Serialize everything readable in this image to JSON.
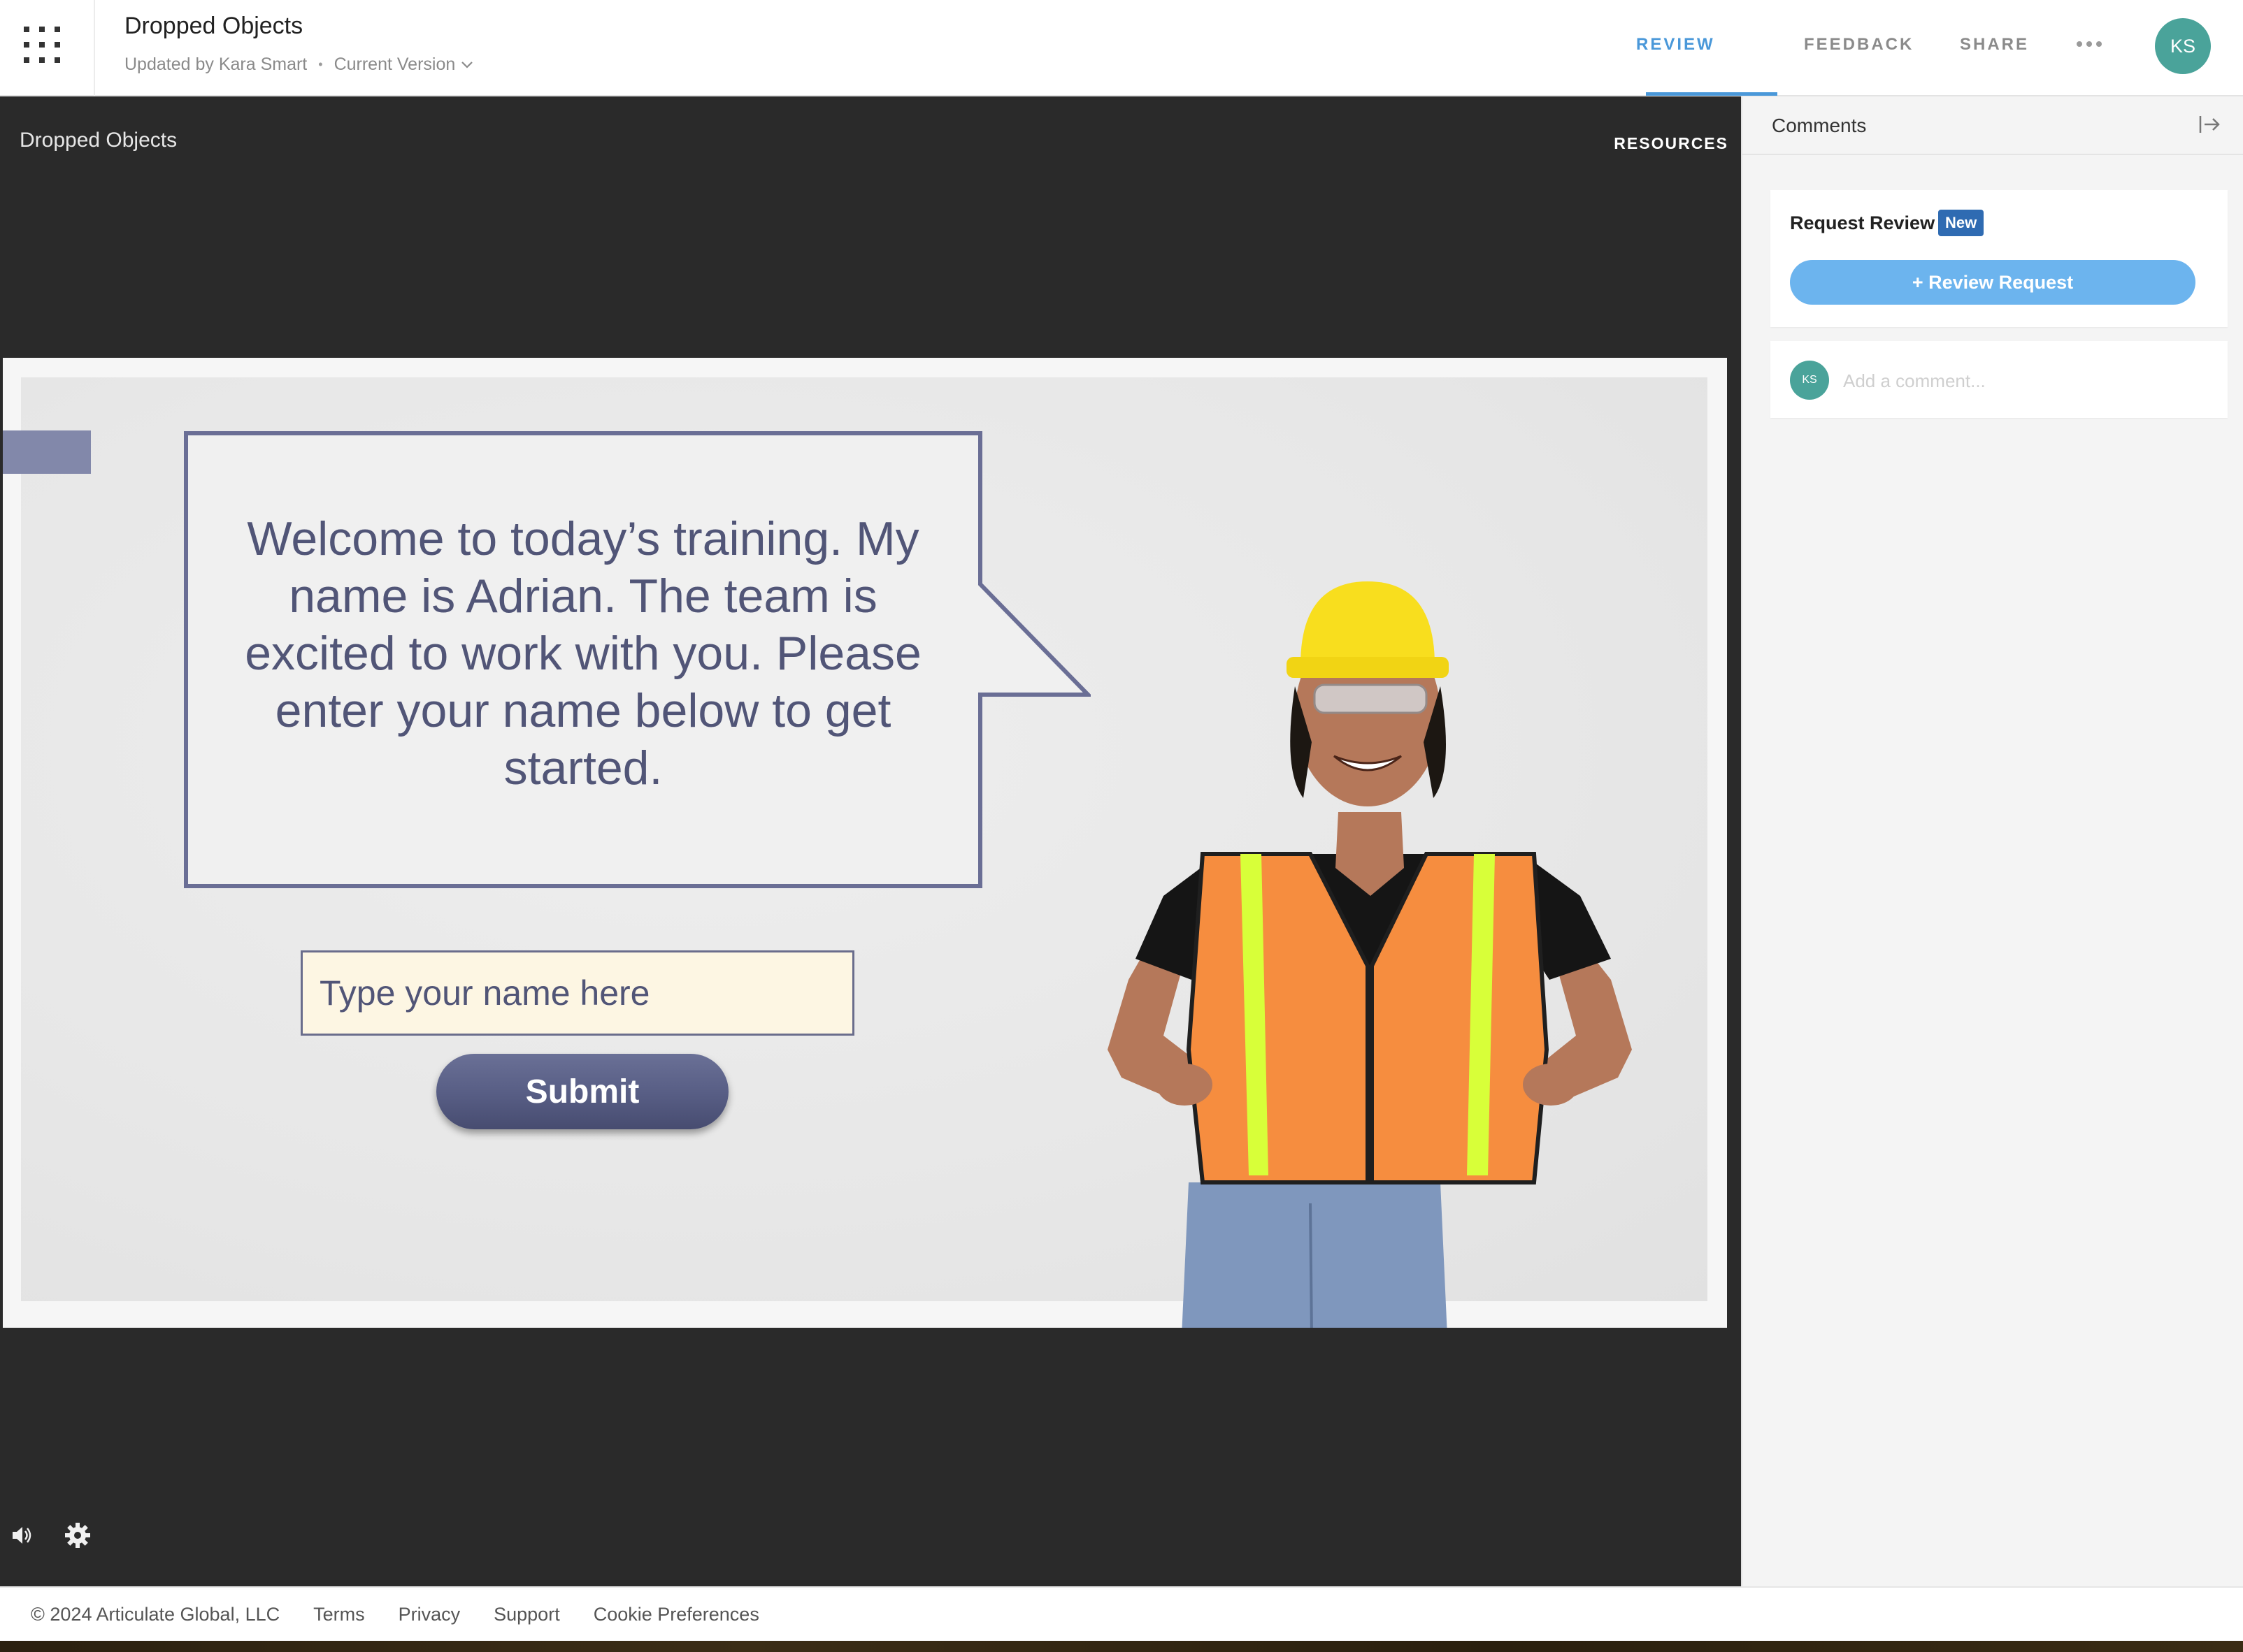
{
  "header": {
    "title": "Dropped Objects",
    "updated_by": "Updated by Kara Smart",
    "separator": "•",
    "version": "Current Version",
    "tabs": [
      {
        "label": "REVIEW",
        "active": true
      },
      {
        "label": "FEEDBACK",
        "active": false
      },
      {
        "label": "SHARE",
        "active": false
      }
    ],
    "more_icon": "more-horizontal-icon",
    "avatar_initials": "KS",
    "accent_color": "#4a98d9"
  },
  "stage": {
    "title": "Dropped Objects",
    "resources_label": "RESOURCES",
    "controls": {
      "audio_icon": "volume-icon",
      "settings_icon": "gear-icon"
    }
  },
  "slide": {
    "speech_text": "Welcome to today’s training. My name is Adrian. The team is excited to work with you. Please enter your name below to get started.",
    "name_placeholder": "Type your name here",
    "submit_label": "Submit"
  },
  "comments": {
    "title": "Comments",
    "collapse_icon": "collapse-panel-icon",
    "request_review_label": "Request Review",
    "new_badge": "New",
    "review_request_button": "+ Review Request",
    "avatar_initials": "KS",
    "comment_placeholder": "Add a comment..."
  },
  "footer": {
    "copyright": "© 2024 Articulate Global, LLC",
    "links": [
      "Terms",
      "Privacy",
      "Support",
      "Cookie Preferences"
    ]
  }
}
